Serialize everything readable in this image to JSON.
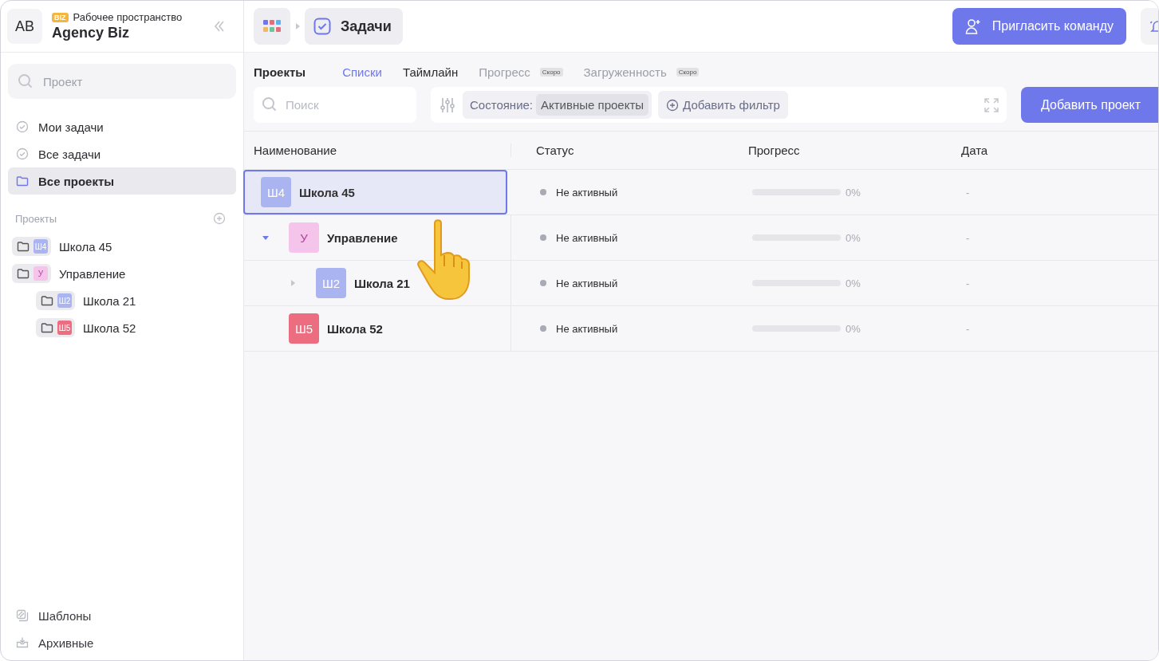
{
  "workspace": {
    "avatar": "AB",
    "badge": "BIZ",
    "label": "Рабочее пространство",
    "name": "Agency Biz"
  },
  "sidebar": {
    "search": {
      "placeholder": "Проект"
    },
    "nav": [
      {
        "label": "Мои задачи",
        "selected": false
      },
      {
        "label": "Все задачи",
        "selected": false
      },
      {
        "label": "Все проекты",
        "selected": true
      }
    ],
    "projects_title": "Проекты",
    "projects": [
      {
        "label": "Школа 45",
        "abbr": "Ш4",
        "color": "#aab4f0"
      },
      {
        "label": "Управление",
        "abbr": "У",
        "color": "#f5c4ea",
        "children": [
          {
            "label": "Школа 21",
            "abbr": "Ш2",
            "color": "#aab4f0"
          },
          {
            "label": "Школа 52",
            "abbr": "Ш5",
            "color": "#ec6d80"
          }
        ]
      }
    ],
    "footer": [
      {
        "label": "Шаблоны"
      },
      {
        "label": "Архивные"
      }
    ]
  },
  "breadcrumb": {
    "label": "Задачи"
  },
  "invite_button": "Пригласить команду",
  "section_title": "Проекты",
  "tabs": [
    {
      "label": "Списки",
      "selected": true,
      "disabled": false
    },
    {
      "label": "Таймлайн",
      "selected": false,
      "disabled": false
    },
    {
      "label": "Прогресс",
      "selected": false,
      "disabled": true,
      "badge": "Скоро"
    },
    {
      "label": "Загруженность",
      "selected": false,
      "disabled": true,
      "badge": "Скоро"
    }
  ],
  "toolbar": {
    "search": {
      "placeholder": "Поиск"
    },
    "filter_label": "Состояние:",
    "filter_value": "Активные проекты",
    "add_filter": "Добавить фильтр",
    "add_project": "Добавить проект"
  },
  "table": {
    "columns": [
      "Наименование",
      "Статус",
      "Прогресс",
      "Дата"
    ],
    "rows": [
      {
        "name": "Школа 45",
        "abbr": "Ш4",
        "color": "#aab4f0",
        "selected": true,
        "status": "Не активный",
        "level": 0,
        "progress": "0%",
        "date": "-"
      },
      {
        "name": "Управление",
        "abbr": "У",
        "color": "#f5c4ea",
        "selected": false,
        "expanded": true,
        "status": "Не активный",
        "level": 0,
        "progress": "0%",
        "date": "-",
        "children": [
          {
            "name": "Школа 21",
            "abbr": "Ш2",
            "color": "#aab4f0",
            "selected": false,
            "expanded": false,
            "status": "Не активный",
            "level": 0,
            "progress": "0%",
            "date": "-"
          },
          {
            "name": "Школа 52",
            "abbr": "Ш5",
            "color": "#ec6d80",
            "selected": false,
            "status": "Не активный",
            "level": 0,
            "progress": "0%",
            "date": "-"
          }
        ]
      }
    ]
  }
}
